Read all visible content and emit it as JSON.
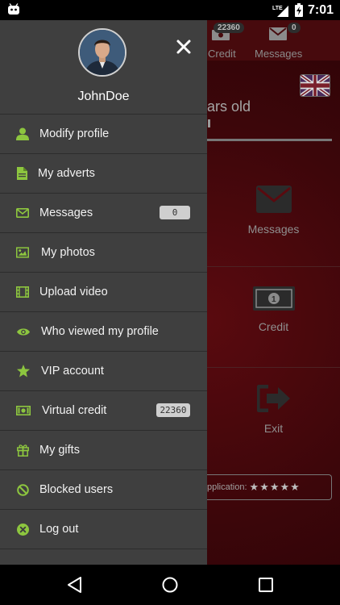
{
  "status_bar": {
    "time": "7:01",
    "network": "LTE"
  },
  "background_app": {
    "tabs": [
      {
        "label": "Credit",
        "badge": "22360"
      },
      {
        "label": "Messages",
        "badge": "0"
      }
    ],
    "age_text": "ars old",
    "tiles": [
      {
        "label": "Messages",
        "icon": "envelope-icon"
      },
      {
        "label": "Credit",
        "icon": "banknote-icon"
      },
      {
        "label": "Exit",
        "icon": "exit-arrow-icon"
      }
    ],
    "reputation_label": "pplication:",
    "reputation_stars": 5
  },
  "drawer": {
    "username": "JohnDoe",
    "menu": [
      {
        "id": "modify-profile",
        "label": "Modify profile",
        "icon": "user-icon"
      },
      {
        "id": "my-adverts",
        "label": "My adverts",
        "icon": "document-icon"
      },
      {
        "id": "messages",
        "label": "Messages",
        "icon": "envelope-icon",
        "count": "0"
      },
      {
        "id": "my-photos",
        "label": "My photos",
        "icon": "photo-icon"
      },
      {
        "id": "upload-video",
        "label": "Upload video",
        "icon": "film-icon"
      },
      {
        "id": "who-viewed",
        "label": "Who viewed my profile",
        "icon": "eye-icon"
      },
      {
        "id": "vip-account",
        "label": "VIP account",
        "icon": "star-icon"
      },
      {
        "id": "virtual-credit",
        "label": "Virtual credit",
        "icon": "money-icon",
        "count": "22360"
      },
      {
        "id": "my-gifts",
        "label": "My gifts",
        "icon": "gift-icon"
      },
      {
        "id": "blocked-users",
        "label": "Blocked users",
        "icon": "ban-icon"
      },
      {
        "id": "log-out",
        "label": "Log out",
        "icon": "close-circle-icon"
      }
    ]
  },
  "colors": {
    "accent_green": "#8dc63f",
    "drawer_bg": "#3f3f3f",
    "app_bg": "#470a0d"
  }
}
